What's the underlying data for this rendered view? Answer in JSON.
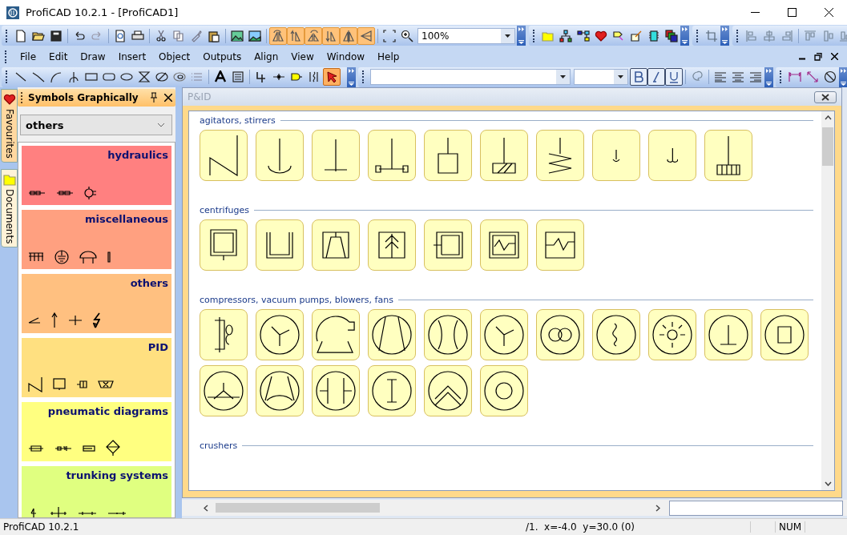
{
  "window": {
    "title": "ProfiCAD 10.2.1 - [ProfiCAD1]"
  },
  "toolbar": {
    "zoom": "100%"
  },
  "menu": [
    "File",
    "Edit",
    "Draw",
    "Insert",
    "Object",
    "Outputs",
    "Align",
    "View",
    "Window",
    "Help"
  ],
  "draw_toolbar": {
    "pointer_selected": true
  },
  "side_tabs": [
    {
      "label": "Favourites",
      "selected": true
    },
    {
      "label": "Documents",
      "selected": false
    }
  ],
  "symbols_panel": {
    "title": "Symbols Graphically",
    "library": "others",
    "categories": [
      {
        "title": "hydraulics",
        "color": "#ff8080"
      },
      {
        "title": "miscellaneous",
        "color": "#ffa080"
      },
      {
        "title": "others",
        "color": "#ffc080"
      },
      {
        "title": "PID",
        "color": "#ffe080"
      },
      {
        "title": "pneumatic diagrams",
        "color": "#ffff80"
      },
      {
        "title": "trunking systems",
        "color": "#e0ff80"
      }
    ]
  },
  "pid_window": {
    "title": "P&ID",
    "sections": [
      {
        "title": "agitators, stirrers"
      },
      {
        "title": "centrifuges"
      },
      {
        "title": "compressors, vacuum pumps, blowers, fans"
      },
      {
        "title": "crushers"
      }
    ]
  },
  "status_bar": {
    "app": "ProfiCAD 10.2.1",
    "position": "/1.  x=-4.0  y=30.0 (0)",
    "num": "NUM"
  }
}
